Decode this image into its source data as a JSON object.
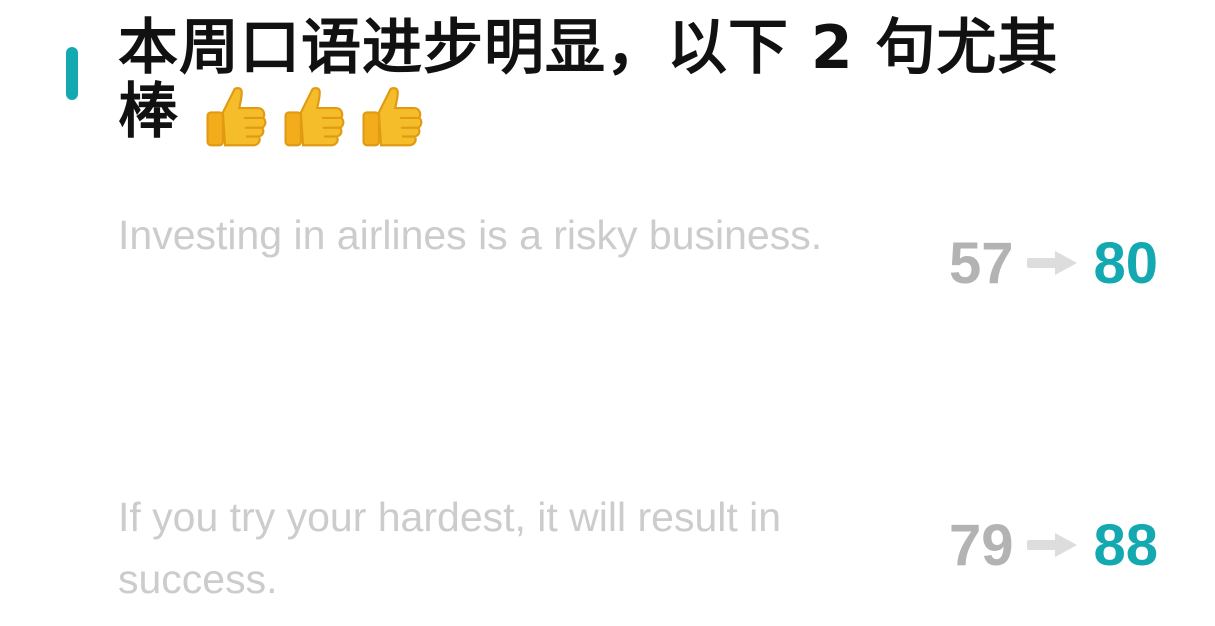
{
  "header": {
    "title": "本周口语进步明显，以下 2 句尤其棒",
    "emoji_icons": [
      "thumbs-up-icon",
      "thumbs-up-icon",
      "thumbs-up-icon"
    ]
  },
  "colors": {
    "accent": "#14a8b0",
    "title_text": "#111111",
    "sentence_text": "#cccccc",
    "old_score": "#b3b3b3",
    "arrow": "#dddddd",
    "thumb": "#f6bd2a"
  },
  "items": [
    {
      "sentence": "Investing in airlines is a risky business.",
      "score_before": "57",
      "score_after": "80",
      "arrow_icon": "right-arrow-icon"
    },
    {
      "sentence": "If you try your hardest, it will result in success.",
      "score_before": "79",
      "score_after": "88",
      "arrow_icon": "right-arrow-icon"
    }
  ]
}
